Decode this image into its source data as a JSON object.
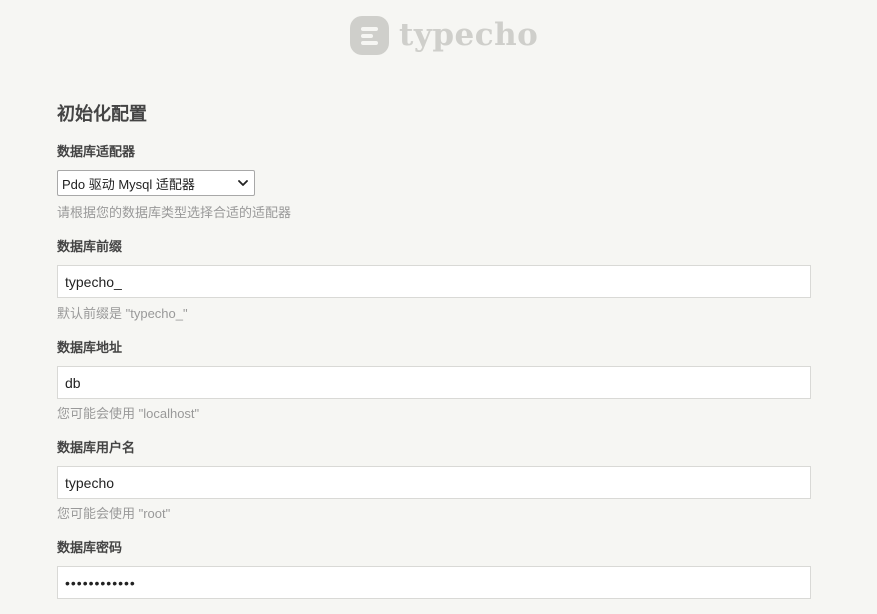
{
  "logo": {
    "text": "typecho"
  },
  "title": "初始化配置",
  "adapter": {
    "label": "数据库适配器",
    "selected": "Pdo 驱动 Mysql 适配器",
    "hint": "请根据您的数据库类型选择合适的适配器"
  },
  "prefix": {
    "label": "数据库前缀",
    "value": "typecho_",
    "hint": "默认前缀是 \"typecho_\""
  },
  "host": {
    "label": "数据库地址",
    "value": "db",
    "hint": "您可能会使用 \"localhost\""
  },
  "user": {
    "label": "数据库用户名",
    "value": "typecho",
    "hint": "您可能会使用 \"root\""
  },
  "password": {
    "label": "数据库密码",
    "value": "typechopass1"
  },
  "colors": {
    "background": "#f6f6f3",
    "logo": "#cfcfcb",
    "label": "#444444",
    "hint": "#999999"
  }
}
